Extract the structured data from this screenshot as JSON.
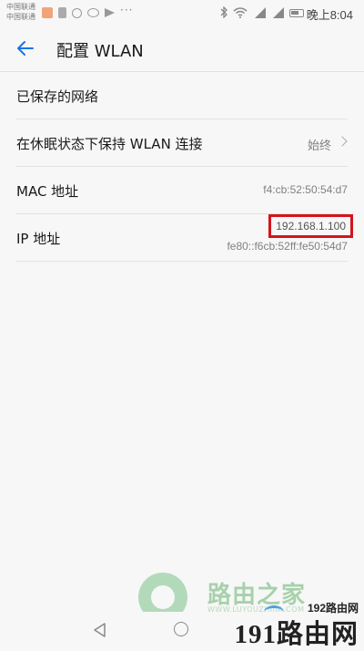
{
  "status_bar": {
    "carrier_line1": "中国联通",
    "carrier_line2": "中国联通",
    "time": "晚上8:04",
    "icons": [
      "notification-app-icon",
      "sim-card-icon",
      "qq-icon",
      "wechat-icon",
      "send-icon",
      "more-dots-icon",
      "bluetooth-icon",
      "wifi-icon",
      "signal-icon",
      "signal-icon",
      "battery-icon"
    ]
  },
  "header": {
    "title": "配置 WLAN"
  },
  "list": {
    "saved_networks": {
      "label": "已保存的网络"
    },
    "keep_wlan_sleep": {
      "label": "在休眠状态下保持 WLAN 连接",
      "value": "始终"
    },
    "mac": {
      "label": "MAC 地址",
      "value": "f4:cb:52:50:54:d7"
    },
    "ip": {
      "label": "IP 地址",
      "ipv4": "192.168.1.100",
      "ipv6": "fe80::f6cb:52ff:fe50:54d7"
    }
  },
  "colors": {
    "accent": "#1a73e8",
    "highlight": "#d4141c"
  },
  "watermarks": {
    "luyouzhijia": "路由之家",
    "luyouzhijia_sub": "WWW.LUYOUZHIJIA.COM",
    "site_top": "192路由网",
    "site_main_num": "191",
    "site_main_text": "路由网"
  }
}
